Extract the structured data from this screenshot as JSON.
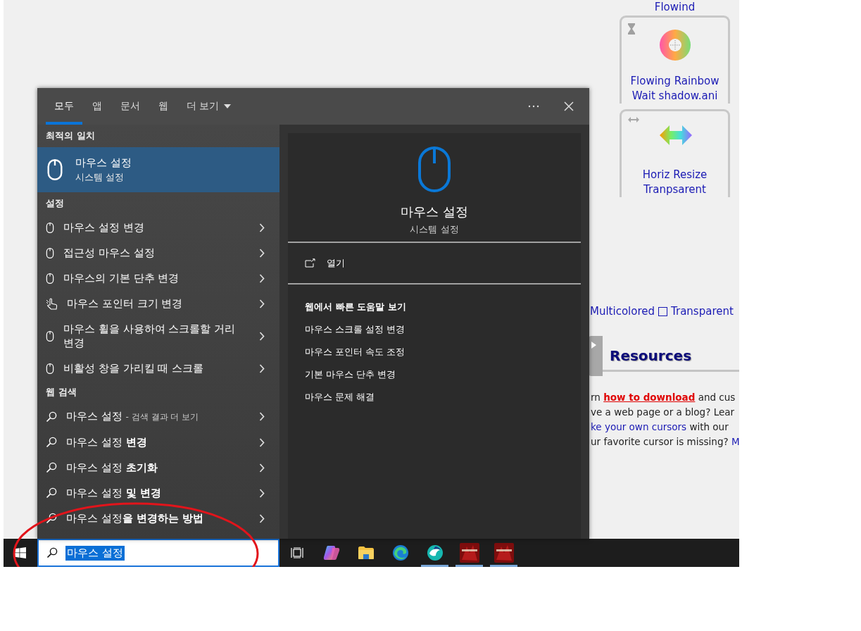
{
  "web_page": {
    "top_caption": "Flowind",
    "cursor_cards": [
      {
        "kind": "wait",
        "caption_lines": [
          "Flowing Rainbow",
          "Wait shadow.ani"
        ]
      },
      {
        "kind": "resize",
        "caption_lines": [
          "Horiz Resize",
          "Tranpsarent"
        ]
      }
    ],
    "filter_label": "Multicolored",
    "transparent_option": {
      "label": "Transparent",
      "checked": false
    },
    "resources_heading": "Resources",
    "resources_lines": [
      [
        {
          "text": "rn "
        },
        {
          "kind": "alert_link",
          "text": "how to download"
        },
        {
          "text": " and cus"
        }
      ],
      [
        {
          "text": "ve a web page or a blog? Lear"
        }
      ],
      [
        {
          "kind": "link",
          "text": "ke your own cursors"
        },
        {
          "text": " with our"
        }
      ],
      [
        {
          "text": "ur favorite cursor is missing? "
        },
        {
          "kind": "link",
          "text": "M"
        }
      ]
    ]
  },
  "search_flyout": {
    "tabs": [
      {
        "label": "모두",
        "selected": true
      },
      {
        "label": "앱",
        "selected": false
      },
      {
        "label": "문서",
        "selected": false
      },
      {
        "label": "웹",
        "selected": false
      },
      {
        "label": "더 보기",
        "selected": false,
        "kind": "dropdown"
      }
    ],
    "best_match": {
      "heading": "최적의 일치",
      "title": "마우스 설정",
      "subtitle": "시스템 설정",
      "selected": true
    },
    "sections": [
      {
        "heading": "설정",
        "items": [
          {
            "kind": "mouse",
            "label": "마우스 설정 변경"
          },
          {
            "kind": "mouse",
            "label": "접근성 마우스 설정"
          },
          {
            "kind": "mouse",
            "label": "마우스의 기본 단추 변경"
          },
          {
            "kind": "pointer",
            "label": "마우스 포인터 크기 변경"
          },
          {
            "kind": "mouse",
            "label": "마우스 휠을 사용하여 스크롤할 거리 변경"
          },
          {
            "kind": "mouse",
            "label": "비활성 창을 가리킬 때 스크롤"
          }
        ]
      },
      {
        "heading": "웹 검색",
        "items": [
          {
            "kind": "search",
            "label": "마우스 설정",
            "suffix": "- 검색 결과 더 보기"
          },
          {
            "kind": "search",
            "label": "마우스 설정 **변경**"
          },
          {
            "kind": "search",
            "label": "마우스 설정 **초기화**"
          },
          {
            "kind": "search",
            "label": "마우스 설정 **및 변경**"
          },
          {
            "kind": "search",
            "label": "마우스 설정**을 변경하는 방법**"
          }
        ]
      }
    ],
    "preview": {
      "title": "마우스 설정",
      "subtitle": "시스템 설정",
      "open_action": "열기",
      "web_heading": "웹에서 빠른 도움말 보기",
      "web_links": [
        "마우스 스크롤 설정 변경",
        "마우스 포인터 속도 조정",
        "기본 마우스 단추 변경",
        "마우스 문제 해결"
      ]
    }
  },
  "taskbar": {
    "search": {
      "value": "마우스 설정",
      "value_selected": true
    },
    "apps": [
      {
        "kind": "task_view",
        "running": false
      },
      {
        "kind": "copilot",
        "running": false
      },
      {
        "kind": "explorer",
        "running": false
      },
      {
        "kind": "edge",
        "running": false
      },
      {
        "kind": "whale",
        "running": true
      },
      {
        "kind": "game",
        "running": true
      },
      {
        "kind": "game",
        "running": true
      }
    ]
  }
}
